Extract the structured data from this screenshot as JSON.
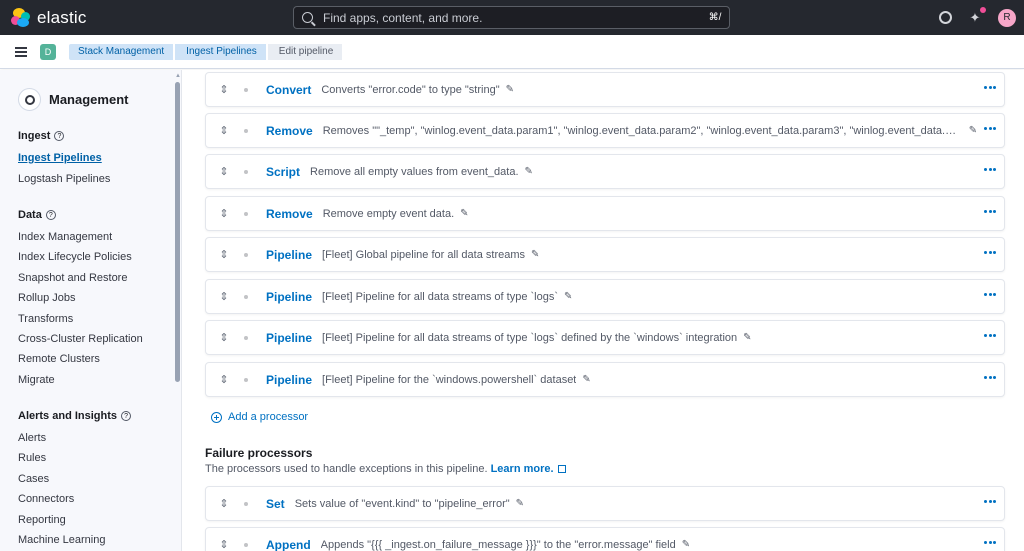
{
  "app": {
    "name": "elastic"
  },
  "search": {
    "placeholder": "Find apps, content, and more.",
    "shortcut": "⌘/"
  },
  "user": {
    "initial": "R"
  },
  "space": {
    "initial": "D"
  },
  "breadcrumbs": [
    "Stack Management",
    "Ingest Pipelines",
    "Edit pipeline"
  ],
  "sidebar": {
    "title": "Management",
    "sections": [
      {
        "title": "Ingest",
        "items": [
          "Ingest Pipelines",
          "Logstash Pipelines"
        ]
      },
      {
        "title": "Data",
        "items": [
          "Index Management",
          "Index Lifecycle Policies",
          "Snapshot and Restore",
          "Rollup Jobs",
          "Transforms",
          "Cross-Cluster Replication",
          "Remote Clusters",
          "Migrate"
        ]
      },
      {
        "title": "Alerts and Insights",
        "items": [
          "Alerts",
          "Rules",
          "Cases",
          "Connectors",
          "Reporting",
          "Machine Learning"
        ]
      }
    ],
    "active_item": "Ingest Pipelines"
  },
  "processors": [
    {
      "type": "Convert",
      "description": "Converts \"error.code\" to type \"string\""
    },
    {
      "type": "Remove",
      "description": "Removes \"\"_temp\", \"winlog.event_data.param1\", \"winlog.event_data.param2\", \"winlog.event_data.param3\", \"winlog.event_data.Sequ…"
    },
    {
      "type": "Script",
      "description": "Remove all empty values from event_data."
    },
    {
      "type": "Remove",
      "description": "Remove empty event data."
    },
    {
      "type": "Pipeline",
      "description": "[Fleet] Global pipeline for all data streams"
    },
    {
      "type": "Pipeline",
      "description": "[Fleet] Pipeline for all data streams of type `logs`"
    },
    {
      "type": "Pipeline",
      "description": "[Fleet] Pipeline for all data streams of type `logs` defined by the `windows` integration"
    },
    {
      "type": "Pipeline",
      "description": "[Fleet] Pipeline for the `windows.powershell` dataset"
    }
  ],
  "add_processor_label": "Add a processor",
  "failure": {
    "title": "Failure processors",
    "subtitle": "The processors used to handle exceptions in this pipeline.",
    "learn_more": "Learn more.",
    "processors": [
      {
        "type": "Set",
        "description": "Sets value of \"event.kind\" to \"pipeline_error\""
      },
      {
        "type": "Append",
        "description": "Appends \"{{{ _ingest.on_failure_message }}}\" to the \"error.message\" field"
      }
    ]
  },
  "colors": {
    "accent": "#0071c2",
    "header": "#25282f",
    "space_badge": "#54b399"
  },
  "icons": {
    "drag": "drag-handle-icon",
    "edit": "pencil-icon",
    "actions": "more-horizontal-icon"
  }
}
